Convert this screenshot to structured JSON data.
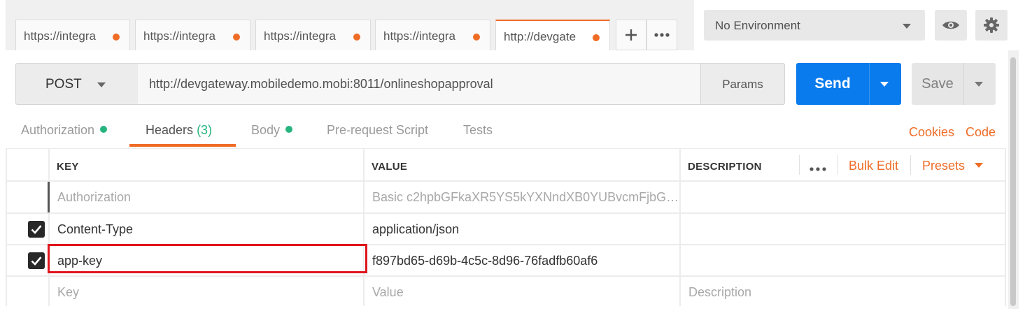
{
  "tabs": [
    {
      "label": "https://integra"
    },
    {
      "label": "https://integra"
    },
    {
      "label": "https://integra"
    },
    {
      "label": "https://integra"
    },
    {
      "label": "http://devgate"
    }
  ],
  "tab_icons": {
    "add": "plus-icon",
    "more": "more-dots-icon"
  },
  "environment": {
    "selected": "No Environment",
    "icons": [
      "eye-icon",
      "gear-icon"
    ]
  },
  "request": {
    "method": "POST",
    "url": "http://devgateway.mobiledemo.mobi:8011/onlineshopapproval",
    "params_label": "Params",
    "send_label": "Send",
    "save_label": "Save"
  },
  "subtabs": {
    "authorization": "Authorization",
    "headers": "Headers",
    "headers_count": "(3)",
    "body": "Body",
    "prerequest": "Pre-request Script",
    "tests": "Tests",
    "cookies": "Cookies",
    "code": "Code"
  },
  "headers_table": {
    "columns": {
      "key": "KEY",
      "value": "VALUE",
      "description": "DESCRIPTION"
    },
    "bulk_edit": "Bulk Edit",
    "presets": "Presets",
    "rows": [
      {
        "key": "Authorization",
        "value": "Basic c2hpbGFkaXR5YS5kYXNndXB0YUBvcmFjbG…",
        "description": "",
        "checked": false
      },
      {
        "key": "Content-Type",
        "value": "application/json",
        "description": "",
        "checked": true
      },
      {
        "key": "app-key",
        "value": "f897bd65-d69b-4c5c-8d96-76fadfb60af6",
        "description": "",
        "checked": true
      }
    ],
    "placeholders": {
      "key": "Key",
      "value": "Value",
      "description": "Description"
    }
  },
  "colors": {
    "accent": "#ef6c27",
    "send": "#097bed",
    "success": "#26b47f",
    "highlight": "#e0151d"
  }
}
